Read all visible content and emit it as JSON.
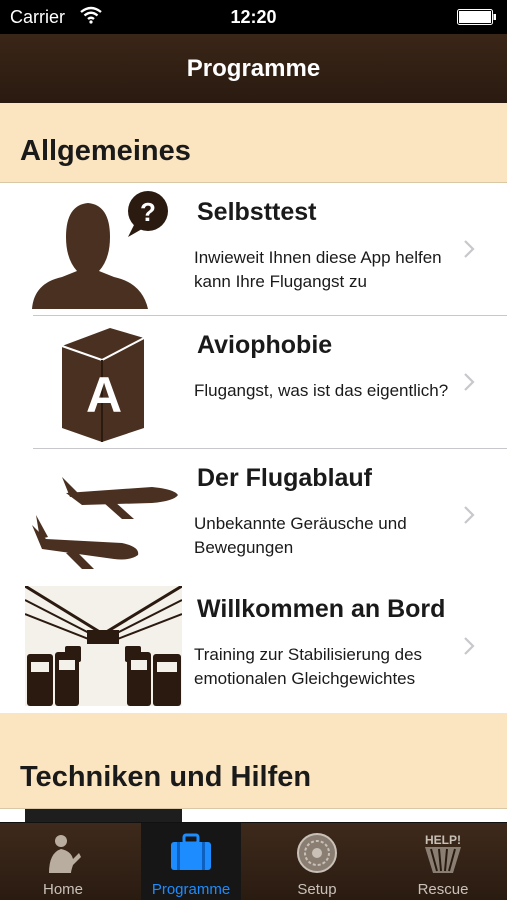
{
  "status_bar": {
    "carrier": "Carrier",
    "time": "12:20"
  },
  "nav": {
    "title": "Programme"
  },
  "sections": [
    {
      "title": "Allgemeines",
      "rows": [
        {
          "title": "Selbsttest",
          "subtitle": "Inwieweit Ihnen diese App helfen kann Ihre Flugangst zu",
          "icon": "person-question-icon"
        },
        {
          "title": "Aviophobie",
          "subtitle": "Flugangst, was ist das eigentlich?",
          "icon": "book-icon"
        },
        {
          "title": "Der Flugablauf",
          "subtitle": "Unbekannte Geräusche und Bewegungen",
          "icon": "airplanes-icon"
        },
        {
          "title": "Willkommen an Bord",
          "subtitle": "Training zur Stabilisierung des emotionalen Gleichgewichtes",
          "icon": "cabin-icon"
        }
      ]
    },
    {
      "title": "Techniken und Hilfen"
    }
  ],
  "tabs": [
    {
      "label": "Home",
      "icon": "person-home-icon",
      "active": false
    },
    {
      "label": "Programme",
      "icon": "briefcase-icon",
      "active": true
    },
    {
      "label": "Setup",
      "icon": "wheel-icon",
      "active": false
    },
    {
      "label": "Rescue",
      "icon": "help-icon",
      "active": false
    }
  ],
  "colors": {
    "section_header_bg": "#fbe4c0",
    "nav_bg": "#2a1a10",
    "icon_brown": "#4a3020",
    "active_tab": "#1d8cff"
  }
}
